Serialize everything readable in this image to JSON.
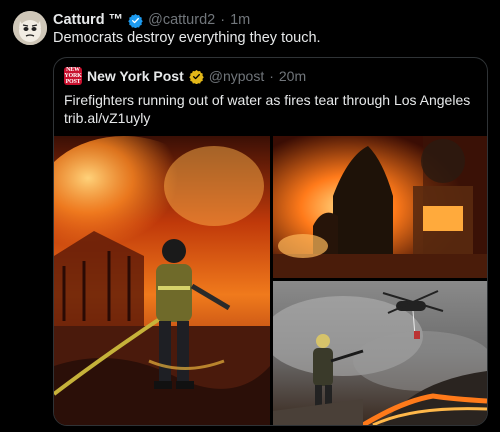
{
  "tweet": {
    "author_name": "Catturd ™",
    "handle": "@catturd2",
    "separator": "·",
    "time": "1m",
    "text": "Democrats destroy everything they touch."
  },
  "quote": {
    "logo_text_line1": "NEW",
    "logo_text_line2": "YORK",
    "logo_text_line3": "POST",
    "author_name": "New York Post",
    "handle": "@nypost",
    "separator": "·",
    "time": "20m",
    "text_line1": "Firefighters running out of water as fires tear through Los Angeles",
    "text_line2": "trib.al/vZ1uyly"
  },
  "colors": {
    "verified_blue": "#1d9bf0",
    "verified_gold": "#e2b719",
    "nypost_red": "#c8102e"
  },
  "images": [
    {
      "name": "firefighter-house-fire-photo"
    },
    {
      "name": "burning-house-photo"
    },
    {
      "name": "helicopter-firefighter-photo"
    }
  ]
}
